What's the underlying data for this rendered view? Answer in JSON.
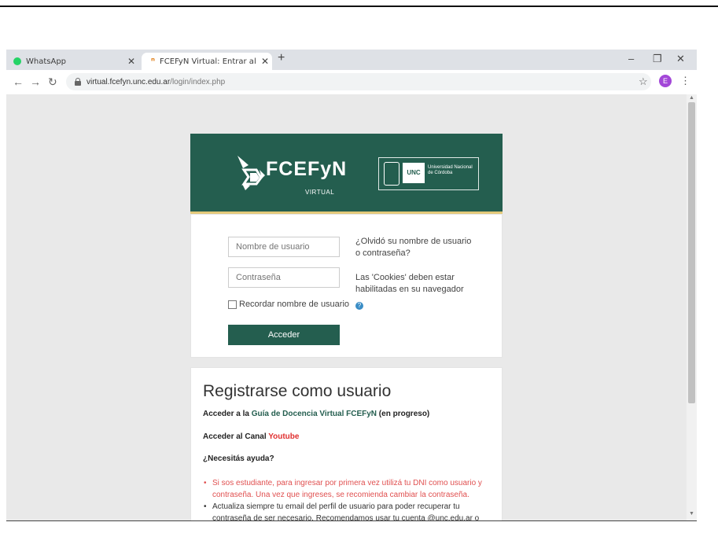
{
  "browser": {
    "tabs": [
      {
        "title": "WhatsApp",
        "favicon": "whatsapp-icon",
        "active": false
      },
      {
        "title": "FCEFyN Virtual: Entrar al sitio",
        "favicon": "fcefyn-favicon",
        "active": true
      }
    ],
    "url_host": "virtual.fcefyn.unc.edu.ar",
    "url_path": "/login/index.php",
    "profile_initial": "E",
    "colors": {
      "tabstrip": "#dee1e6",
      "avatar": "#a347d8"
    }
  },
  "brand": {
    "name": "FCEFyN",
    "sub": "VIRTUAL",
    "unc_badge": "UNC",
    "unc_name": "Universidad Nacional de Córdoba",
    "colors": {
      "primary": "#245e4f",
      "accent": "#e3c97a"
    }
  },
  "login": {
    "username_placeholder": "Nombre de usuario",
    "password_placeholder": "Contraseña",
    "remember_label": "Recordar nombre de usuario",
    "remember_checked": false,
    "submit_label": "Acceder",
    "forgot_text": "¿Olvidó su nombre de usuario o contraseña?",
    "cookies_text": "Las 'Cookies' deben estar habilitadas en su navegador"
  },
  "register": {
    "title": "Registrarse como usuario",
    "guide_prefix": "Acceder a la ",
    "guide_link": "Guía de Docencia Virtual FCEFyN",
    "guide_suffix": " (en progreso)",
    "channel_prefix": "Acceder al Canal ",
    "channel_link": "Youtube",
    "help_heading": "¿Necesitás ayuda?",
    "bullets": [
      "Si sos estudiante, para ingresar por primera vez utilizá tu DNI como usuario y contraseña. Una vez que ingreses, se recomienda cambiar la contraseña.",
      "Actualiza siempre tu email del perfil de usuario para poder recuperar tu contraseña de ser necesario. Recomendamos usar tu cuenta @unc.edu.ar o"
    ]
  }
}
